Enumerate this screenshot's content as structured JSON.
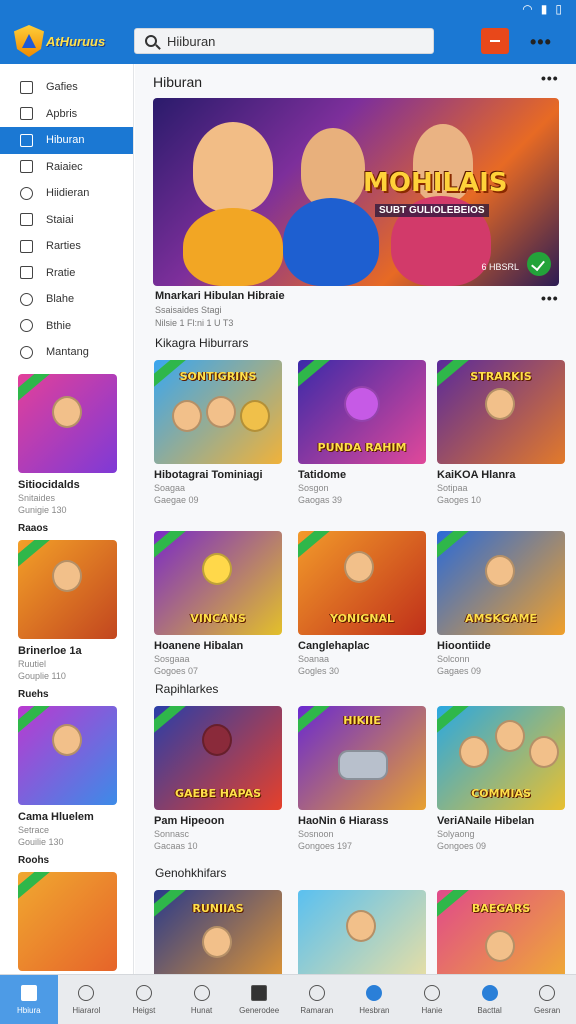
{
  "app": {
    "logo_text": "AtHuruus"
  },
  "search": {
    "value": "Hiiburan",
    "placeholder": ""
  },
  "sidebar": {
    "items": [
      {
        "label": "Gafies",
        "icon": "grid-icon"
      },
      {
        "label": "Apbris",
        "icon": "apps-icon"
      },
      {
        "label": "Hiburan",
        "icon": "entertainment-icon",
        "active": true
      },
      {
        "label": "Raiaiec",
        "icon": "star-icon"
      },
      {
        "label": "Hiidieran",
        "icon": "compass-icon"
      },
      {
        "label": "Staiai",
        "icon": "chart-icon"
      },
      {
        "label": "Rarties",
        "icon": "plus-icon"
      },
      {
        "label": "Rratie",
        "icon": "link-icon"
      },
      {
        "label": "Blahe",
        "icon": "circle-icon"
      },
      {
        "label": "Bthie",
        "icon": "search-icon"
      },
      {
        "label": "Mantang",
        "icon": "settings-icon"
      }
    ],
    "cards": [
      {
        "title": "Sitiocidalds",
        "sub": "Snitaides",
        "meta": "Gunigie 130"
      },
      {
        "title": "Brinerloe 1a",
        "sub": "Ruutiel",
        "meta": "Gouplie 110"
      },
      {
        "title": "Cama Hluelem",
        "sub": "Setrace",
        "meta": "Gouilie 130"
      }
    ],
    "headers": [
      "Raaos",
      "Ruehs",
      "Roohs"
    ]
  },
  "main": {
    "hero_section": "Hiburan",
    "hero": {
      "logo": "MOHILAIS",
      "subtitle": "SUBT GULIOLEBEIOS",
      "tag": "6 HBSRL",
      "title": "Mnarkari Hibulan Hibraie",
      "line1": "Ssaisaides Stagi",
      "line2": "Nilsie 1 Fl:ni 1 U T3"
    },
    "sections": [
      "Kikagra Hiburrars",
      "Rapihlarkes",
      "Genohkhifars"
    ],
    "cards": [
      {
        "title": "Hibotagrai Tominiagi",
        "sub": "Soagaa",
        "meta": "Gaegae 09",
        "label": "SONTIGRINS"
      },
      {
        "title": "Tatidome",
        "sub": "Sosgon",
        "meta": "Gaogas 39",
        "label": "PUNDA RAHIM"
      },
      {
        "title": "KaiKOA Hlanra",
        "sub": "Sotipaa",
        "meta": "Gaoges 10",
        "label": "STRARKIS"
      },
      {
        "title": "Hoanene Hibalan",
        "sub": "Sosgaaa",
        "meta": "Gogoes 07",
        "label": "VINCANS"
      },
      {
        "title": "Canglehaplac",
        "sub": "Soanaa",
        "meta": "Gogles 30",
        "label": "YONIGNAL"
      },
      {
        "title": "Hioontiide",
        "sub": "Solconn",
        "meta": "Gagaes 09",
        "label": "AMSKGAME"
      },
      {
        "title": "Pam Hipeoon",
        "sub": "Sonnasc",
        "meta": "Gacaas 10",
        "label": "GAEBE HAPAS"
      },
      {
        "title": "HaoNin 6 Hiarass",
        "sub": "Sosnoon",
        "meta": "Gongoes 197",
        "label": "HIKIIE"
      },
      {
        "title": "VeriANaile Hibelan",
        "sub": "Solyaong",
        "meta": "Gongoes 09",
        "label": "COMMIAS"
      },
      {
        "title": "",
        "sub": "",
        "meta": "",
        "label": "RUNIIAS"
      },
      {
        "title": "",
        "sub": "",
        "meta": "",
        "label": ""
      },
      {
        "title": "",
        "sub": "",
        "meta": "",
        "label": "BAEGARS"
      }
    ]
  },
  "bottom_nav": [
    {
      "label": "Hbiura",
      "icon": "home-icon",
      "active": true
    },
    {
      "label": "Hiararol",
      "icon": "mic-icon"
    },
    {
      "label": "Heigst",
      "icon": "face-icon"
    },
    {
      "label": "Hunat",
      "icon": "star-icon"
    },
    {
      "label": "Generodee",
      "icon": "grid-icon"
    },
    {
      "label": "Ramaran",
      "icon": "disc-icon"
    },
    {
      "label": "Hesbran",
      "icon": "shield-icon",
      "accent": true
    },
    {
      "label": "Hanie",
      "icon": "check-icon"
    },
    {
      "label": "Bacttal",
      "icon": "badge-icon",
      "accent": true
    },
    {
      "label": "Gesran",
      "icon": "user-icon"
    }
  ]
}
